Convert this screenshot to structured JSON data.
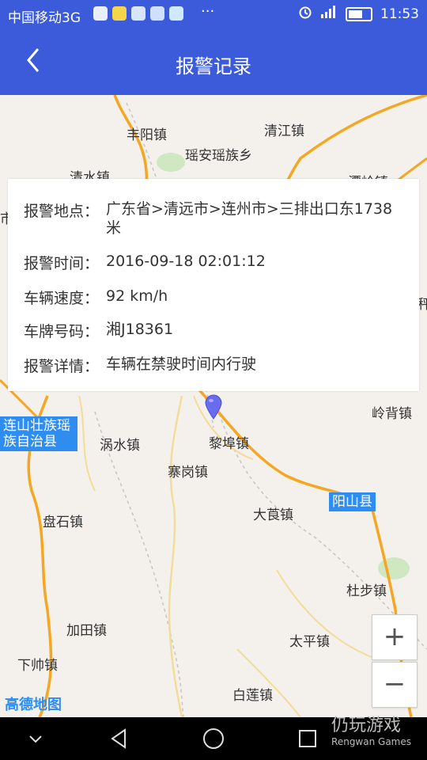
{
  "status": {
    "carrier": "中国移动3G",
    "more": "···",
    "time": "11:53",
    "apps": [
      "shield-app-icon",
      "store-app-icon",
      "radio-app-icon",
      "message-app-icon",
      "weather-app-icon"
    ]
  },
  "header": {
    "title": "报警记录",
    "back": "back-arrow-icon"
  },
  "alarm": {
    "location_label": "报警地点：",
    "location_value": "广东省>清远市>连州市>三排出口东1738米",
    "time_label": "报警时间：",
    "time_value": "2016-09-18 02:01:12",
    "speed_label": "车辆速度：",
    "speed_value": "92  km/h",
    "plate_label": "车牌号码：",
    "plate_value": "湘J18361",
    "detail_label": "报警详情：",
    "detail_value": "车辆在禁驶时间内行驶"
  },
  "map": {
    "labels": {
      "fengyang": "丰阳镇",
      "qingjiang": "清江镇",
      "yaoan": "瑶安瑶族乡",
      "qingshui": "清水镇",
      "xiaojiang": "潭岭镇",
      "lingbei": "岭背镇",
      "yongshui": "涡水镇",
      "libu": "黎埠镇",
      "zhaigang": "寨岗镇",
      "panshi": "盘石镇",
      "dagen": "大莨镇",
      "dubu": "杜步镇",
      "jiatian": "加田镇",
      "taiping": "太平镇",
      "xiashuai": "下帅镇",
      "bailian": "白莲镇",
      "left_edge": "市",
      "right_edge": "秤"
    },
    "counties": {
      "lianshan": "连山壮族瑶族自治县",
      "yangshan": "阳山县"
    },
    "zoom_in": "+",
    "zoom_out": "−",
    "logo": "高德地图"
  },
  "watermark": {
    "big": "仍玩游戏",
    "small": "Rengwan Games"
  },
  "colors": {
    "accent": "#3b5bdb",
    "road": "#f5a623",
    "county": "#2f8df0",
    "marker": "#6a6cf0"
  }
}
